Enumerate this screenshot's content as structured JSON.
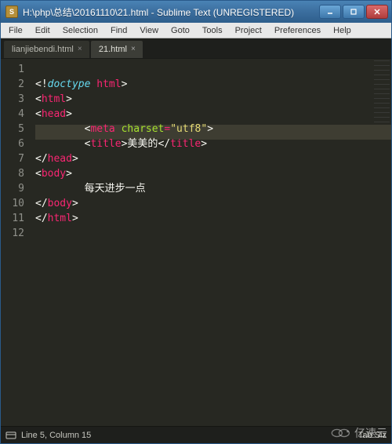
{
  "window": {
    "title": "H:\\php\\总结\\20161110\\21.html - Sublime Text (UNREGISTERED)"
  },
  "menu": [
    "File",
    "Edit",
    "Selection",
    "Find",
    "View",
    "Goto",
    "Tools",
    "Project",
    "Preferences",
    "Help"
  ],
  "tabs": [
    {
      "label": "lianjiebendi.html",
      "active": false
    },
    {
      "label": "21.html",
      "active": true
    }
  ],
  "editor": {
    "line_numbers": [
      "1",
      "2",
      "3",
      "4",
      "5",
      "6",
      "7",
      "8",
      "9",
      "10",
      "11",
      "12"
    ],
    "highlighted_line_index": 4,
    "code_lines": [
      {
        "indent": 0,
        "parts": [
          {
            "c": "tok-bracket",
            "t": "<!"
          },
          {
            "c": "tok-doctype-kw",
            "t": "doctype "
          },
          {
            "c": "tok-tagname",
            "t": "html"
          },
          {
            "c": "tok-bracket",
            "t": ">"
          }
        ]
      },
      {
        "indent": 0,
        "parts": [
          {
            "c": "tok-bracket",
            "t": "<"
          },
          {
            "c": "tok-tagname",
            "t": "html"
          },
          {
            "c": "tok-bracket",
            "t": ">"
          }
        ]
      },
      {
        "indent": 0,
        "parts": [
          {
            "c": "tok-bracket",
            "t": "<"
          },
          {
            "c": "tok-tagname",
            "t": "head"
          },
          {
            "c": "tok-bracket",
            "t": ">"
          }
        ]
      },
      {
        "indent": 2,
        "parts": [
          {
            "c": "tok-bracket",
            "t": "<"
          },
          {
            "c": "tok-tagname",
            "t": "meta "
          },
          {
            "c": "tok-attr",
            "t": "charset"
          },
          {
            "c": "tok-op",
            "t": "="
          },
          {
            "c": "tok-str",
            "t": "\"utf8\""
          },
          {
            "c": "tok-bracket",
            "t": ">"
          }
        ]
      },
      {
        "indent": 2,
        "parts": [
          {
            "c": "tok-bracket",
            "t": "<"
          },
          {
            "c": "tok-tagname",
            "t": "title"
          },
          {
            "c": "tok-bracket",
            "t": ">"
          },
          {
            "c": "tok-text",
            "t": "美美的"
          },
          {
            "c": "tok-bracket",
            "t": "</"
          },
          {
            "c": "tok-tagname",
            "t": "title"
          },
          {
            "c": "tok-bracket",
            "t": ">"
          }
        ]
      },
      {
        "indent": 0,
        "parts": [
          {
            "c": "tok-bracket",
            "t": "</"
          },
          {
            "c": "tok-tagname",
            "t": "head"
          },
          {
            "c": "tok-bracket",
            "t": ">"
          }
        ]
      },
      {
        "indent": 0,
        "parts": [
          {
            "c": "tok-bracket",
            "t": "<"
          },
          {
            "c": "tok-tagname",
            "t": "body"
          },
          {
            "c": "tok-bracket",
            "t": ">"
          }
        ]
      },
      {
        "indent": 2,
        "parts": [
          {
            "c": "tok-text",
            "t": "每天进步一点"
          }
        ]
      },
      {
        "indent": 0,
        "parts": [
          {
            "c": "tok-bracket",
            "t": "</"
          },
          {
            "c": "tok-tagname",
            "t": "body"
          },
          {
            "c": "tok-bracket",
            "t": ">"
          }
        ]
      },
      {
        "indent": 0,
        "parts": [
          {
            "c": "tok-bracket",
            "t": "</"
          },
          {
            "c": "tok-tagname",
            "t": "html"
          },
          {
            "c": "tok-bracket",
            "t": ">"
          }
        ]
      },
      {
        "indent": 0,
        "parts": []
      },
      {
        "indent": 0,
        "parts": []
      }
    ]
  },
  "status": {
    "position": "Line 5, Column 15",
    "tab_size_label": "Tab Siz"
  },
  "watermark": "亿速云"
}
